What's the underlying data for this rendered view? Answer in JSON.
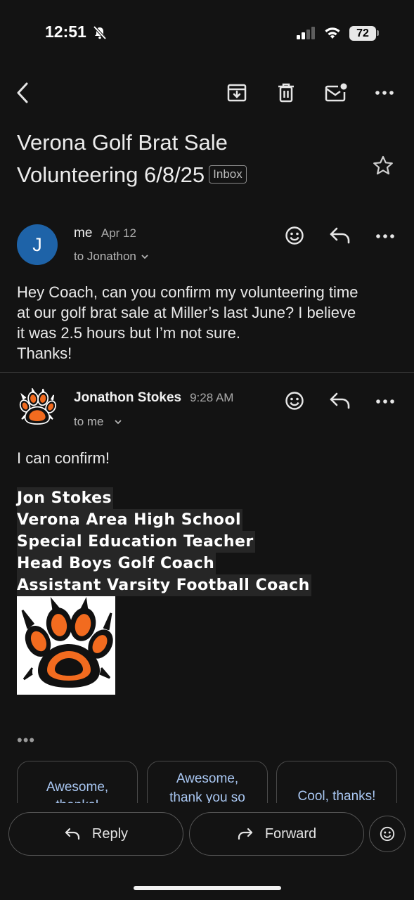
{
  "status_bar": {
    "time": "12:51",
    "battery": "72"
  },
  "toolbar": {
    "back_icon": "chevron-left-icon",
    "archive_icon": "archive-icon",
    "delete_icon": "trash-icon",
    "unread_icon": "mark-unread-icon",
    "more_icon": "more-horizontal-icon"
  },
  "subject": {
    "line1": "Verona Golf Brat Sale",
    "line2": "Volunteering 6/8/25",
    "label": "Inbox"
  },
  "messages": [
    {
      "avatar_letter": "J",
      "avatar_color": "#1e63a8",
      "sender": "me",
      "date": "Apr 12",
      "to": "to Jonathon",
      "body_lines": [
        "Hey Coach, can you confirm my volunteering time",
        "at our golf brat sale at Miller’s last June? I believe",
        "it was 2.5 hours but I’m not sure.",
        "Thanks!"
      ]
    },
    {
      "sender": "Jonathon Stokes",
      "date": "9:28 AM",
      "to": "to me",
      "body": "I can confirm!",
      "signature": [
        "Jon Stokes",
        "Verona Area High School",
        "Special Education Teacher",
        "Head Boys Golf Coach",
        "Assistant Varsity Football Coach"
      ],
      "logo": "tiger-paw-logo",
      "logo_colors": {
        "orange": "#f26b1f",
        "black": "#111111"
      }
    }
  ],
  "smart_replies": [
    {
      "line1": "Awesome,",
      "line2": "thanks!"
    },
    {
      "line1": "Awesome,",
      "line2": "thank you so"
    },
    {
      "line1": "Cool, thanks!",
      "line2": ""
    }
  ],
  "actions": {
    "reply": "Reply",
    "forward": "Forward"
  },
  "colors": {
    "accent_link": "#a9c7f2",
    "background": "#131313"
  }
}
